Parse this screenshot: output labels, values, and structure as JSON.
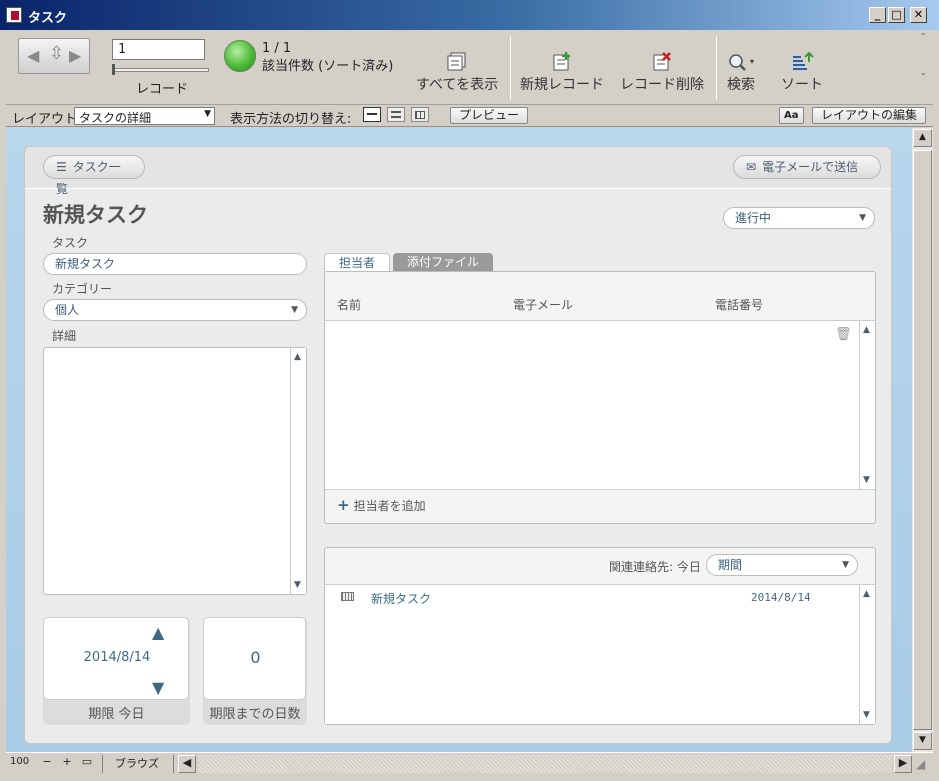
{
  "window": {
    "title": "タスク"
  },
  "toolbar": {
    "record_number": "1",
    "record_label": "レコード",
    "found_count": "1 / 1",
    "found_text": "該当件数 (ソート済み)",
    "show_all": "すべてを表示",
    "new_record": "新規レコード",
    "delete_record": "レコード削除",
    "find": "検索",
    "sort": "ソート"
  },
  "layoutbar": {
    "layout_label": "レイアウト:",
    "layout_value": "タスクの詳細",
    "view_as_label": "表示方法の切り替え:",
    "preview": "プレビュー",
    "edit_layout": "レイアウトの編集",
    "text_size_icon": "Aa"
  },
  "card": {
    "back_button": "タスク一覧",
    "email_button": "電子メールで送信",
    "title": "新規タスク",
    "status_value": "進行中",
    "task_label": "タスク",
    "task_value": "新規タスク",
    "category_label": "カテゴリー",
    "category_value": "個人",
    "details_label": "詳細",
    "due_date": "2014/8/14",
    "due_label": "期限 今日",
    "days_value": "0",
    "days_label": "期限までの日数"
  },
  "tabs": [
    {
      "label": "担当者"
    },
    {
      "label": "添付ファイル"
    }
  ],
  "assignees": {
    "columns": [
      "名前",
      "電子メール",
      "電話番号"
    ],
    "add_label": "担当者を追加"
  },
  "related": {
    "filter_label": "関連連絡先: 今日",
    "filter_value": "期間",
    "rows": [
      {
        "name": "新規タスク",
        "date": "2014/8/14"
      }
    ]
  },
  "statusbar": {
    "zoom": "100",
    "mode": "ブラウズ"
  }
}
